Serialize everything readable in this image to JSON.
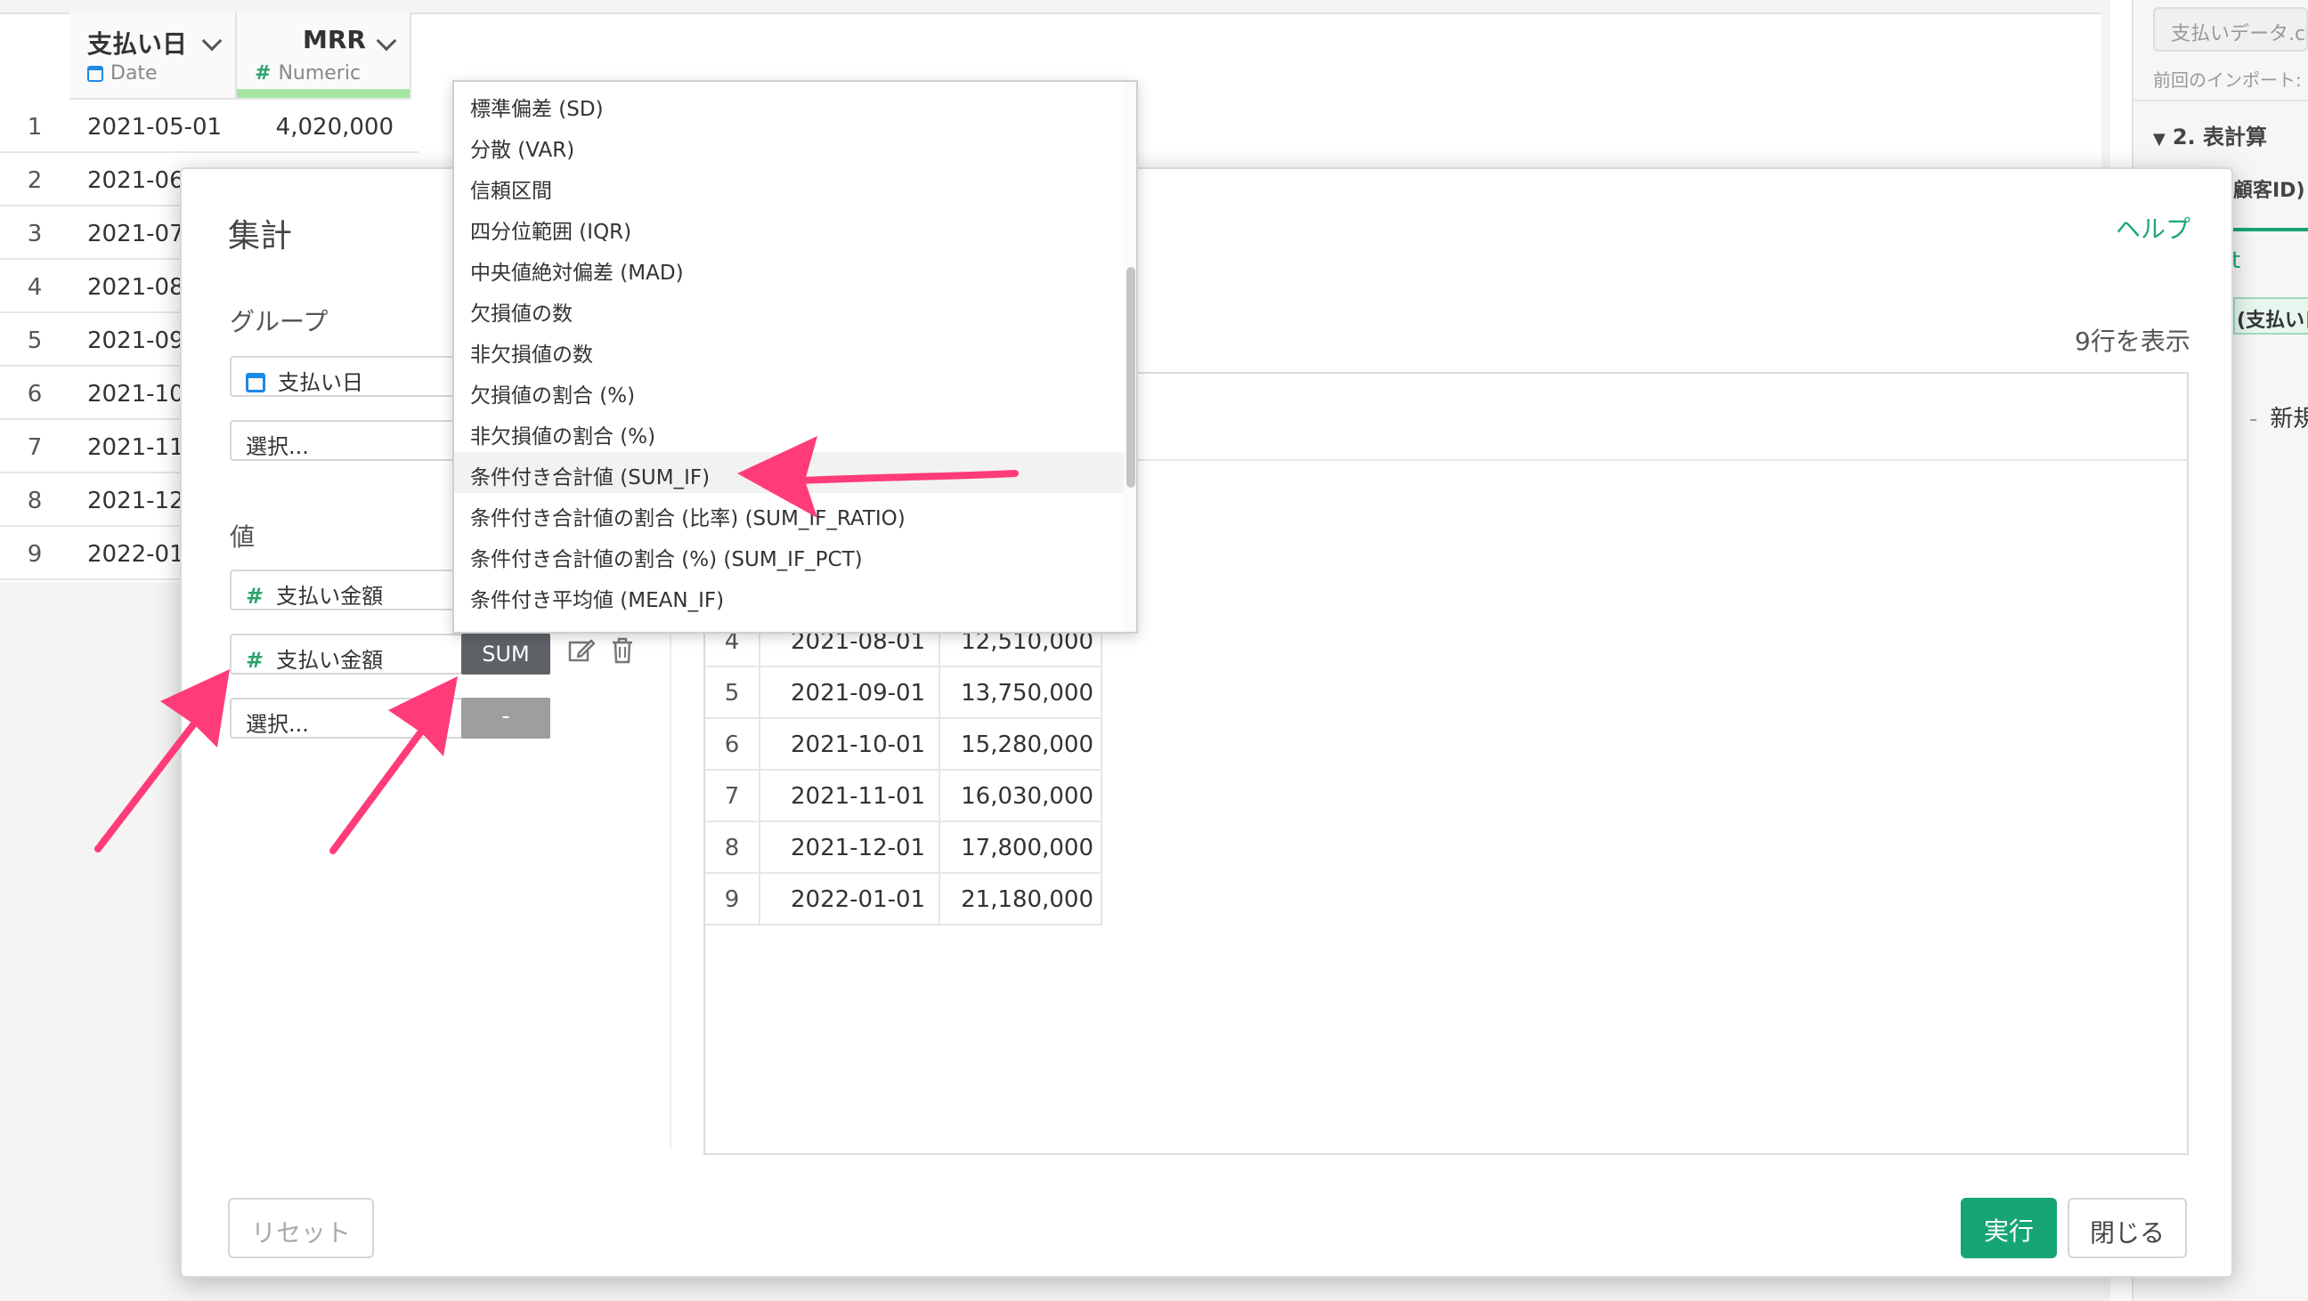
{
  "grid": {
    "columns": [
      {
        "name": "支払い日",
        "type": "Date",
        "type_icon": "calendar-icon"
      },
      {
        "name": "MRR",
        "type": "Numeric",
        "type_icon": "hash-icon"
      }
    ],
    "rows": [
      {
        "num": "1",
        "date": "2021-05-01",
        "mrr": "4,020,000"
      },
      {
        "num": "2",
        "date": "2021-06"
      },
      {
        "num": "3",
        "date": "2021-07"
      },
      {
        "num": "4",
        "date": "2021-08"
      },
      {
        "num": "5",
        "date": "2021-09"
      },
      {
        "num": "6",
        "date": "2021-10"
      },
      {
        "num": "7",
        "date": "2021-11"
      },
      {
        "num": "8",
        "date": "2021-12"
      },
      {
        "num": "9",
        "date": "2022-01"
      }
    ]
  },
  "right_panel": {
    "input_text": "支払いデータ.c",
    "previous_import": "前回のインポート:",
    "section": "2. 表計算",
    "new_label": "新規ス",
    "partial_customer_id": "顧客ID)",
    "partial_payment_date": "(支払い日",
    "partial_t": "t"
  },
  "modal": {
    "title": "集計",
    "help": "ヘルプ",
    "group_label": "グループ",
    "group_field": "支払い日",
    "select_placeholder": "選択...",
    "value_label": "値",
    "value_field_1": "支払い金額",
    "value_field_2": "支払い金額",
    "sum_button": "SUM",
    "dash_button": "-",
    "rows_count": "9行を表示",
    "reset": "リセット",
    "run": "実行",
    "close": "閉じる",
    "preview_rows": [
      {
        "num": "4",
        "date": "2021-08-01",
        "value": "12,510,000"
      },
      {
        "num": "5",
        "date": "2021-09-01",
        "value": "13,750,000"
      },
      {
        "num": "6",
        "date": "2021-10-01",
        "value": "15,280,000"
      },
      {
        "num": "7",
        "date": "2021-11-01",
        "value": "16,030,000"
      },
      {
        "num": "8",
        "date": "2021-12-01",
        "value": "17,800,000"
      },
      {
        "num": "9",
        "date": "2022-01-01",
        "value": "21,180,000"
      }
    ]
  },
  "dropdown": {
    "items": [
      "標準偏差 (SD)",
      "分散 (VAR)",
      "信頼区間",
      "四分位範囲 (IQR)",
      "中央値絶対偏差 (MAD)",
      "欠損値の数",
      "非欠損値の数",
      "欠損値の割合 (%)",
      "非欠損値の割合 (%)",
      "条件付き合計値 (SUM_IF)",
      "条件付き合計値の割合 (比率) (SUM_IF_RATIO)",
      "条件付き合計値の割合 (%) (SUM_IF_PCT)",
      "条件付き平均値 (MEAN_IF)"
    ],
    "highlighted_index": 9
  },
  "colors": {
    "accent_green": "#17a673",
    "annotation_pink": "#ff3c78",
    "date_blue": "#1e88e5",
    "numeric_green": "#2aa36a"
  }
}
